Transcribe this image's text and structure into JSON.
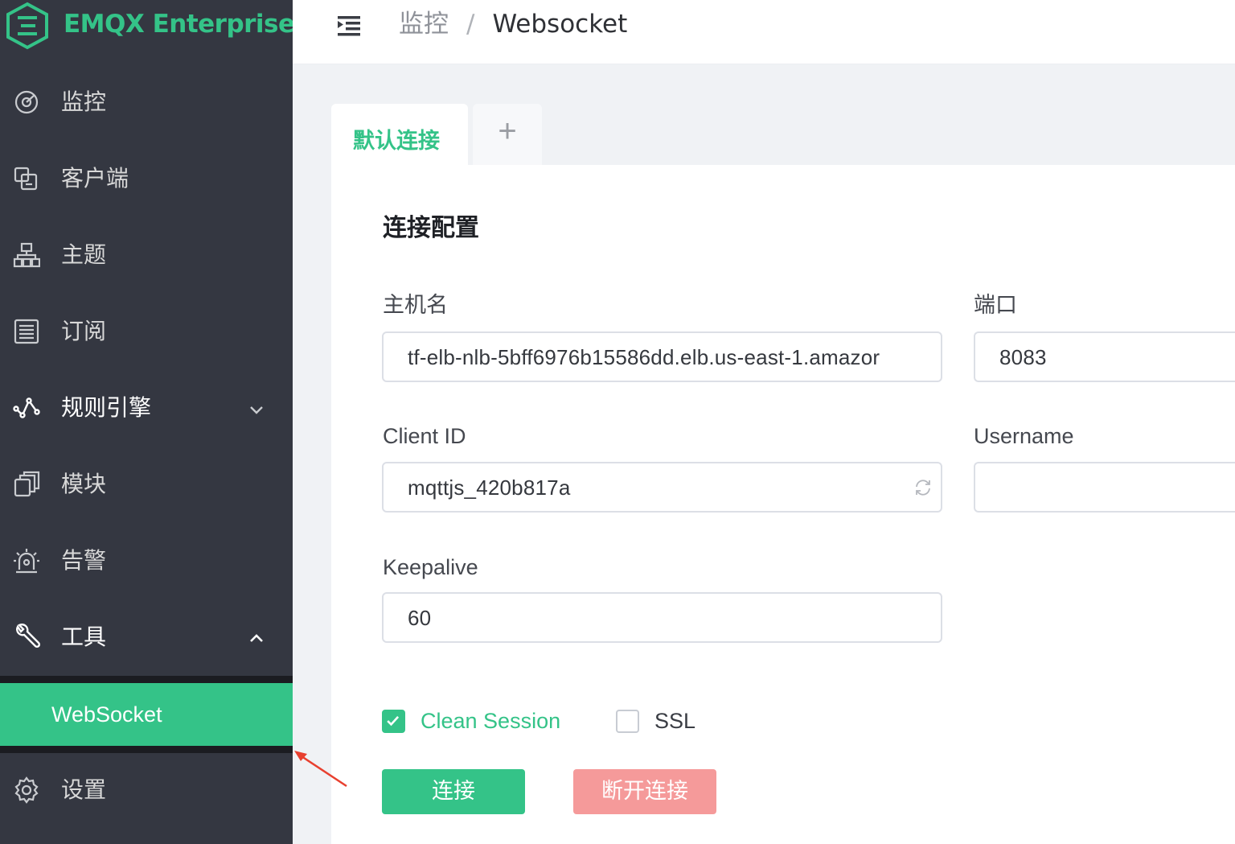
{
  "app": {
    "brand": "EMQX Enterprise",
    "accent_color": "#34c388",
    "sidebar_bg": "#343741",
    "danger_color": "#f59a9a"
  },
  "sidebar": {
    "items": [
      {
        "label": "监控",
        "icon": "dashboard-icon"
      },
      {
        "label": "客户端",
        "icon": "clients-icon"
      },
      {
        "label": "主题",
        "icon": "topics-icon"
      },
      {
        "label": "订阅",
        "icon": "subscriptions-icon"
      },
      {
        "label": "规则引擎",
        "icon": "rule-engine-icon",
        "expandable": true,
        "expanded": false
      },
      {
        "label": "模块",
        "icon": "modules-icon"
      },
      {
        "label": "告警",
        "icon": "alarm-icon"
      },
      {
        "label": "工具",
        "icon": "tools-icon",
        "expandable": true,
        "expanded": true
      },
      {
        "label": "设置",
        "icon": "settings-icon"
      }
    ],
    "submenu_active": "WebSocket"
  },
  "header": {
    "breadcrumb": [
      "监控",
      "Websocket"
    ],
    "separator": "/"
  },
  "tabs": {
    "active_label": "默认连接",
    "add_label": "+"
  },
  "form": {
    "title": "连接配置",
    "host_label": "主机名",
    "host_value": "tf-elb-nlb-5bff6976b15586dd.elb.us-east-1.amazor",
    "port_label": "端口",
    "port_value": "8083",
    "client_id_label": "Client ID",
    "client_id_value": "mqttjs_420b817a",
    "username_label": "Username",
    "username_value": "",
    "keepalive_label": "Keepalive",
    "keepalive_value": "60",
    "clean_session_label": "Clean Session",
    "clean_session_checked": true,
    "ssl_label": "SSL",
    "ssl_checked": false
  },
  "buttons": {
    "connect": "连接",
    "disconnect": "断开连接"
  }
}
